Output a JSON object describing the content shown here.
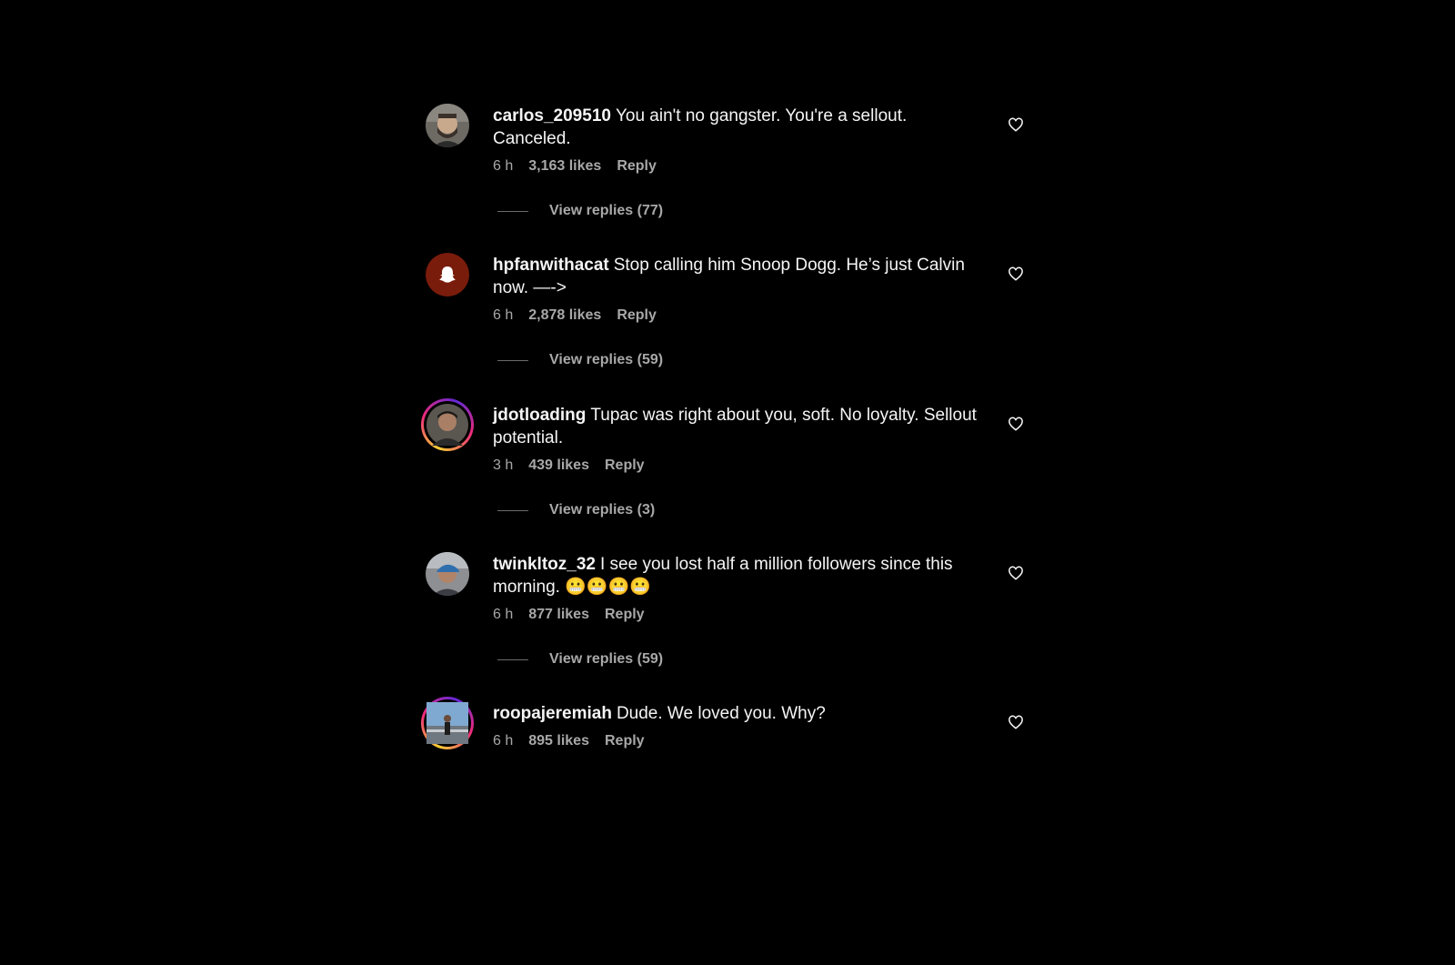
{
  "comments": [
    {
      "username": "carlos_209510",
      "text": "You ain't no gangster. You're a sellout. Canceled.",
      "time": "6 h",
      "likes": "3,163 likes",
      "reply_label": "Reply",
      "replies_label": "View replies (77)",
      "avatar": "bearded-man-photo",
      "story_ring": false
    },
    {
      "username": "hpfanwithacat",
      "text": "Stop calling him Snoop Dogg. He’s just Calvin now. —->",
      "time": "6 h",
      "likes": "2,878 likes",
      "reply_label": "Reply",
      "replies_label": "View replies (59)",
      "avatar": "snapchat-ghost-icon",
      "story_ring": false
    },
    {
      "username": "jdotloading",
      "text": "Tupac was right about you, soft. No loyalty. Sellout potential.",
      "time": "3 h",
      "likes": "439 likes",
      "reply_label": "Reply",
      "replies_label": "View replies (3)",
      "avatar": "young-man-photo",
      "story_ring": true
    },
    {
      "username": "twinkltoz_32",
      "text": "I see you lost half a million followers since this morning. 😬😬😬😬",
      "time": "6 h",
      "likes": "877 likes",
      "reply_label": "Reply",
      "replies_label": "View replies (59)",
      "avatar": "man-with-cap-photo",
      "story_ring": false
    },
    {
      "username": "roopajeremiah",
      "text": "Dude. We loved you. Why?",
      "time": "6 h",
      "likes": "895 likes",
      "reply_label": "Reply",
      "avatar": "person-outdoors-photo",
      "story_ring": true
    }
  ],
  "colors": {
    "background": "#000000",
    "primary_text": "#f5f5f5",
    "secondary_text": "#a8a8a8",
    "snapchat_avatar_bg": "#7a1c0c"
  },
  "icons": {
    "like": "heart-outline-icon"
  }
}
